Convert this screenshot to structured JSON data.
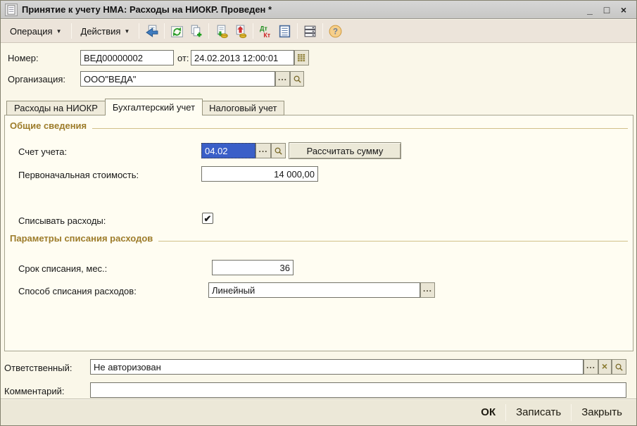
{
  "window": {
    "title": "Принятие к учету НМА: Расходы на НИОКР. Проведен *",
    "controls": {
      "minimize": "_",
      "maximize": "□",
      "close": "×"
    }
  },
  "toolbar": {
    "operation": {
      "label": "Операция"
    },
    "actions": {
      "label": "Действия"
    },
    "dtkt": {
      "dt": "Дт",
      "kt": "Кт"
    },
    "icon_names": [
      "save",
      "refresh",
      "copy-add",
      "post-document",
      "unpost-document",
      "dt-kt",
      "document-journal",
      "registers",
      "help"
    ]
  },
  "header_fields": {
    "number": {
      "label": "Номер:",
      "value": "ВЕД00000002"
    },
    "date": {
      "label": "от:",
      "value": "24.02.2013 12:00:01"
    },
    "organization": {
      "label": "Организация:",
      "value": "ООО\"ВЕДА\""
    }
  },
  "tabs": [
    {
      "label": "Расходы на НИОКР",
      "active": false
    },
    {
      "label": "Бухгалтерский учет",
      "active": true
    },
    {
      "label": "Налоговый учет",
      "active": false
    }
  ],
  "general": {
    "title": "Общие сведения",
    "account": {
      "label": "Счет учета:",
      "value": "04.02"
    },
    "calc_button": "Рассчитать сумму",
    "cost": {
      "label": "Первоначальная стоимость:",
      "value": "14 000,00"
    },
    "writeoff": {
      "label": "Списывать расходы:",
      "checked": true,
      "glyph": "✔"
    }
  },
  "params": {
    "title": "Параметры списания расходов",
    "term": {
      "label": "Срок списания, мес.:",
      "value": "36"
    },
    "method": {
      "label": "Способ списания расходов:",
      "value": "Линейный"
    }
  },
  "footer": {
    "responsible": {
      "label": "Ответственный:",
      "value": "Не авторизован"
    },
    "comment": {
      "label": "Комментарий:",
      "value": ""
    },
    "buttons": {
      "ok": "ОК",
      "save": "Записать",
      "close": "Закрыть"
    }
  },
  "glyphs": {
    "ellipsis": "...",
    "clear": "×",
    "dropdown": "▼",
    "question": "?"
  },
  "colors": {
    "selection_blue": "#3a5fc8",
    "group_title_brown": "#9d7c2a",
    "titlebar_gray": "#cfcfcf",
    "toolbar_beige": "#ece4da",
    "body_cream": "#faf7e9",
    "panel_cream": "#fffdf2",
    "bottombar_tan": "#ece8d8"
  }
}
